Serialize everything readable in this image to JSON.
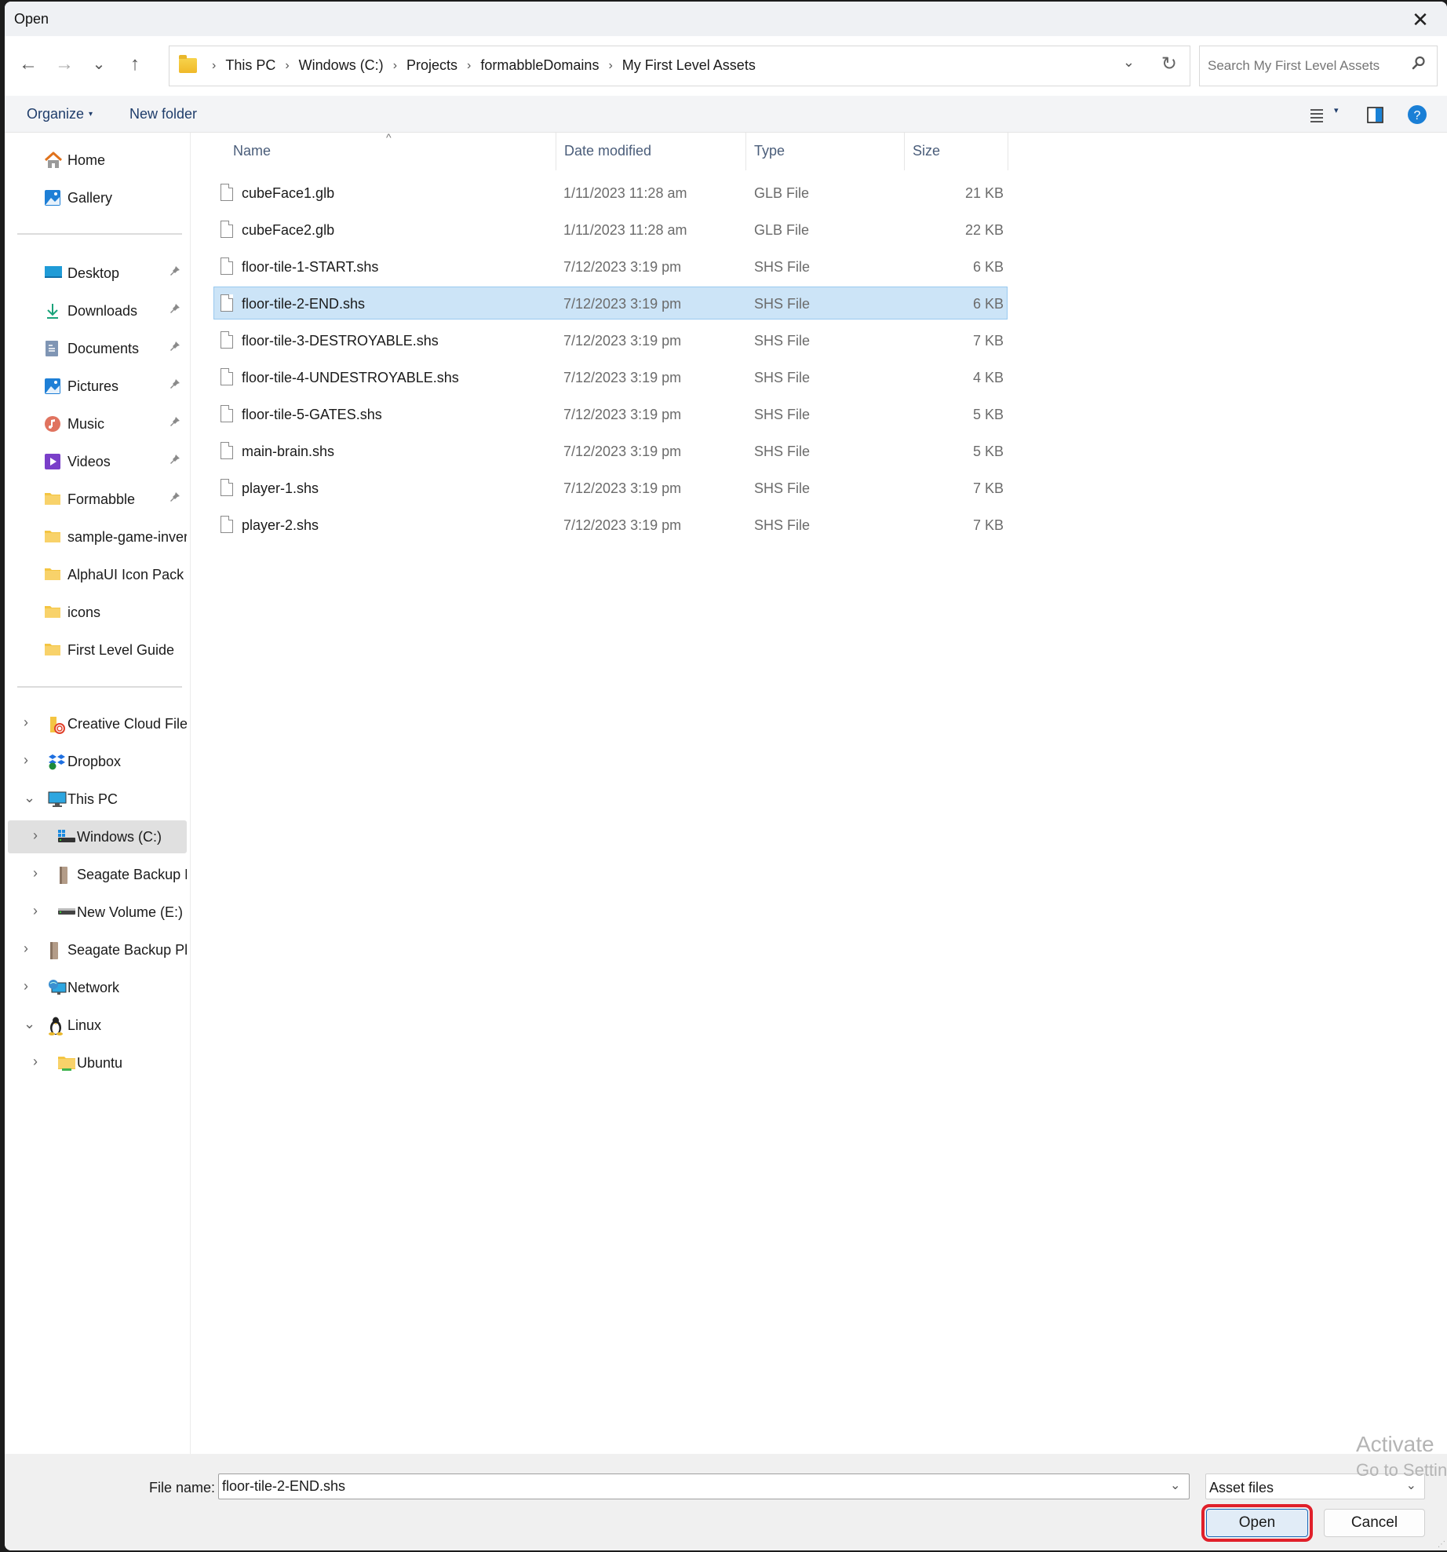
{
  "window": {
    "title": "Open",
    "close_label": "✕"
  },
  "nav": {
    "back_icon": "←",
    "forward_icon": "→",
    "recent_icon": "⌄",
    "up_icon": "↑",
    "breadcrumb": [
      "This PC",
      "Windows (C:)",
      "Projects",
      "formabbleDomains",
      "My First Level Assets"
    ],
    "separator": "›",
    "dropdown_icon": "⌄",
    "refresh_icon": "↻"
  },
  "search": {
    "placeholder": "Search My First Level Assets",
    "icon": "⚲"
  },
  "toolbar": {
    "organize_label": "Organize",
    "organize_caret": "▾",
    "new_folder_label": "New folder",
    "view_caret": "▾"
  },
  "sidebar": {
    "quick": [
      {
        "label": "Home",
        "icon": "home"
      },
      {
        "label": "Gallery",
        "icon": "gallery"
      }
    ],
    "pinned": [
      {
        "label": "Desktop",
        "icon": "desktop",
        "pinned": true
      },
      {
        "label": "Downloads",
        "icon": "downloads",
        "pinned": true
      },
      {
        "label": "Documents",
        "icon": "documents",
        "pinned": true
      },
      {
        "label": "Pictures",
        "icon": "pictures",
        "pinned": true
      },
      {
        "label": "Music",
        "icon": "music",
        "pinned": true
      },
      {
        "label": "Videos",
        "icon": "videos",
        "pinned": true
      },
      {
        "label": "Formabble",
        "icon": "folder",
        "pinned": true
      },
      {
        "label": "sample-game-inver",
        "icon": "folder",
        "pinned": false
      },
      {
        "label": "AlphaUI Icon Pack S",
        "icon": "folder",
        "pinned": false
      },
      {
        "label": "icons",
        "icon": "folder",
        "pinned": false
      },
      {
        "label": "First Level Guide",
        "icon": "folder",
        "pinned": false
      }
    ],
    "tree": [
      {
        "label": "Creative Cloud Files",
        "icon": "creative-cloud",
        "level": 0,
        "expander": "›"
      },
      {
        "label": "Dropbox",
        "icon": "dropbox",
        "level": 0,
        "expander": "›"
      },
      {
        "label": "This PC",
        "icon": "this-pc",
        "level": 0,
        "expander": "⌄"
      },
      {
        "label": "Windows (C:)",
        "icon": "windows-drive",
        "level": 1,
        "expander": "›",
        "selected": true
      },
      {
        "label": "Seagate Backup Pl",
        "icon": "external-drive",
        "level": 1,
        "expander": "›"
      },
      {
        "label": "New Volume (E:)",
        "icon": "drive",
        "level": 1,
        "expander": "›"
      },
      {
        "label": "Seagate Backup Plu",
        "icon": "external-drive",
        "level": 0,
        "expander": "›"
      },
      {
        "label": "Network",
        "icon": "network",
        "level": 0,
        "expander": "›"
      },
      {
        "label": "Linux",
        "icon": "linux",
        "level": 0,
        "expander": "⌄"
      },
      {
        "label": "Ubuntu",
        "icon": "linux-folder",
        "level": 1,
        "expander": "›"
      }
    ],
    "pin_icon": "📌"
  },
  "filelist": {
    "columns": [
      "Name",
      "Date modified",
      "Type",
      "Size"
    ],
    "sort_indicator": "^",
    "rows": [
      {
        "name": "cubeFace1.glb",
        "date": "1/11/2023 11:28 am",
        "type": "GLB File",
        "size": "21 KB"
      },
      {
        "name": "cubeFace2.glb",
        "date": "1/11/2023 11:28 am",
        "type": "GLB File",
        "size": "22 KB"
      },
      {
        "name": "floor-tile-1-START.shs",
        "date": "7/12/2023 3:19 pm",
        "type": "SHS File",
        "size": "6 KB"
      },
      {
        "name": "floor-tile-2-END.shs",
        "date": "7/12/2023 3:19 pm",
        "type": "SHS File",
        "size": "6 KB",
        "selected": true
      },
      {
        "name": "floor-tile-3-DESTROYABLE.shs",
        "date": "7/12/2023 3:19 pm",
        "type": "SHS File",
        "size": "7 KB"
      },
      {
        "name": "floor-tile-4-UNDESTROYABLE.shs",
        "date": "7/12/2023 3:19 pm",
        "type": "SHS File",
        "size": "4 KB"
      },
      {
        "name": "floor-tile-5-GATES.shs",
        "date": "7/12/2023 3:19 pm",
        "type": "SHS File",
        "size": "5 KB"
      },
      {
        "name": "main-brain.shs",
        "date": "7/12/2023 3:19 pm",
        "type": "SHS File",
        "size": "5 KB"
      },
      {
        "name": "player-1.shs",
        "date": "7/12/2023 3:19 pm",
        "type": "SHS File",
        "size": "7 KB"
      },
      {
        "name": "player-2.shs",
        "date": "7/12/2023 3:19 pm",
        "type": "SHS File",
        "size": "7 KB"
      }
    ]
  },
  "footer": {
    "file_name_label": "File name:",
    "file_name_value": "floor-tile-2-END.shs",
    "file_type_value": "Asset files",
    "dropdown_icon": "⌄",
    "open_label": "Open",
    "cancel_label": "Cancel"
  },
  "watermark": {
    "line1": "Activate",
    "line2": "Go to Settin"
  },
  "colors": {
    "selection_bg": "#cce4f7",
    "selection_border": "#99c9ef",
    "highlight_outline": "#e0202a",
    "accent": "#1a67b8"
  }
}
